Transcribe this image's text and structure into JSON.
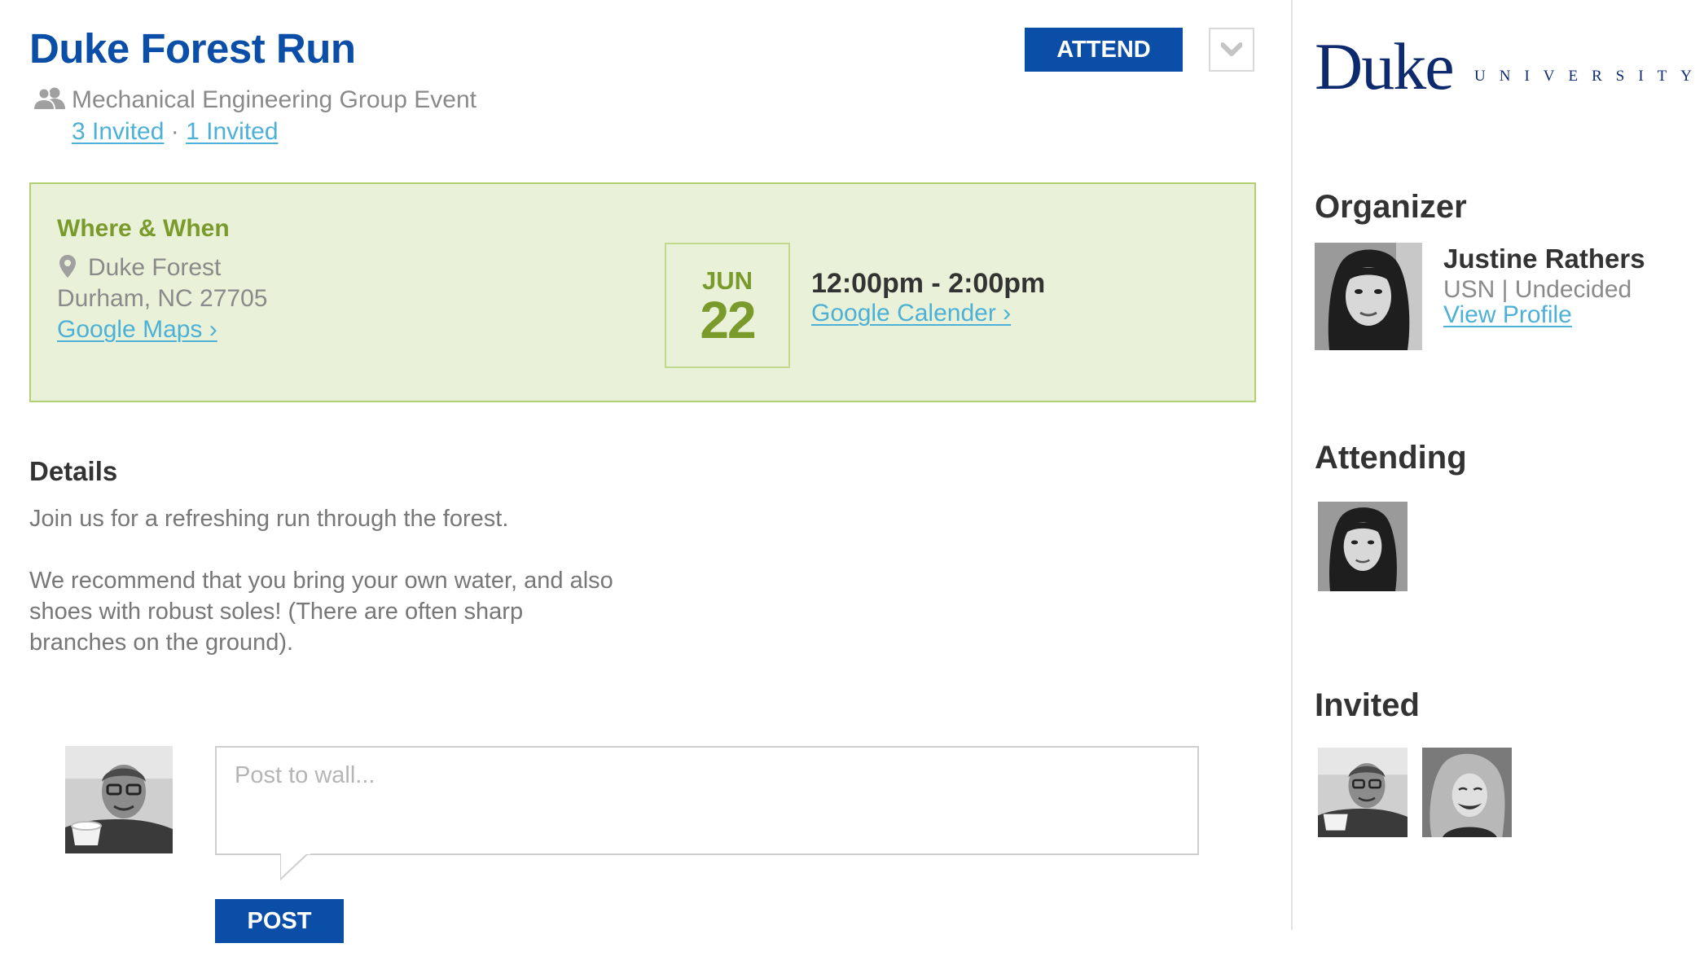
{
  "event": {
    "title": "Duke Forest Run",
    "group_label": "Mechanical Engineering Group Event",
    "invited_link_1": "3 Invited",
    "invited_separator": "·",
    "invited_link_2": "1 Invited",
    "attend_label": "ATTEND",
    "dropdown_icon": "chevron-down-icon"
  },
  "where_when": {
    "heading": "Where & When",
    "location_name": "Duke Forest",
    "location_address": "Durham, NC 27705",
    "maps_link": "Google Maps ›",
    "date_month": "JUN",
    "date_day": "22",
    "time_range": "12:00pm - 2:00pm",
    "calendar_link": "Google Calender ›"
  },
  "details": {
    "heading": "Details",
    "paragraph_1": "Join us for a refreshing run through the forest.",
    "paragraph_2": "We recommend that you bring your own water, and also shoes with robust soles! (There are often sharp branches on the ground)."
  },
  "wall": {
    "placeholder": "Post to wall...",
    "post_label": "POST"
  },
  "sidebar": {
    "logo_word": "Duke",
    "logo_sub": "UNIVERSITY",
    "organizer_heading": "Organizer",
    "organizer_name": "Justine Rathers",
    "organizer_meta": "USN | Undecided",
    "organizer_link": "View Profile",
    "attending_heading": "Attending",
    "invited_heading": "Invited"
  },
  "colors": {
    "brand_blue": "#0a4ea8",
    "link_blue": "#4db0d6",
    "where_green_bg": "#e9f2d8",
    "where_green_text": "#7a9a2c"
  }
}
